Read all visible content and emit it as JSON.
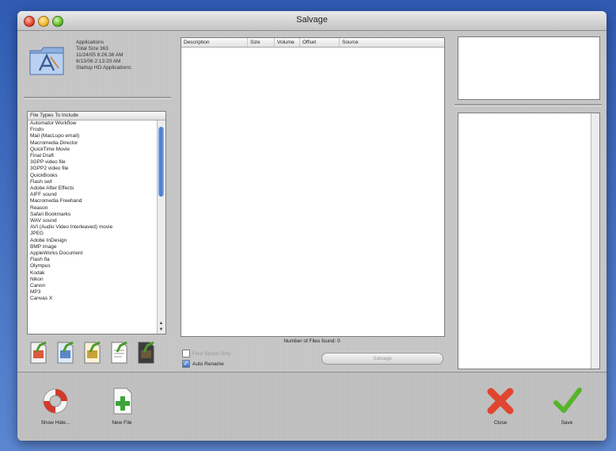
{
  "window": {
    "title": "Salvage"
  },
  "info": {
    "lines": [
      "Applications",
      "Total Size 363",
      "11/24/05 6:26:36 AM",
      "8/13/06 2:13:20 AM",
      "Startup HD:Applications:"
    ]
  },
  "file_types": {
    "header": "File Types To Include",
    "items": [
      "Automator Workflow",
      "Frodo",
      "Mail (MacLupo email)",
      "Macromedia Director",
      "QuickTime Movie",
      "Final Draft",
      "3GPP video file",
      "3GPP2 video file",
      "QuickBooks",
      "Flash swf",
      "Adobe After Effects",
      "AIFF sound",
      "Macromedia Freehand",
      "Reason",
      "Safari Bookmarks",
      "WAV sound",
      "AVI (Audio Video Interleaved) movie",
      "JPEG",
      "Adobe InDesign",
      "BMP image",
      "AppleWorks Document",
      "Flash fla",
      "Olympus",
      "Kodak",
      "Nikon",
      "Canon",
      "MP3",
      "Canvas X"
    ]
  },
  "results": {
    "columns": [
      "Description",
      "Size",
      "Volume",
      "Offset",
      "Source"
    ]
  },
  "found_text": "Number of Files found: 0",
  "options": {
    "free_space_only": {
      "label": "Free Space Only",
      "checked": false
    },
    "auto_rename": {
      "label": "Auto Rename",
      "checked": true
    }
  },
  "salvage_button": "Salvage",
  "toolbar": {
    "show_hide": "Show Hide...",
    "new_file": "New File",
    "close": "Close",
    "save": "Save"
  },
  "colors": {
    "accent": "#3f74d0",
    "close_red": "#e0462f",
    "save_green": "#55b52a"
  },
  "icons": [
    "folder-icon",
    "lifebuoy-icon",
    "new-file-icon",
    "close-x-icon",
    "checkmark-icon"
  ]
}
